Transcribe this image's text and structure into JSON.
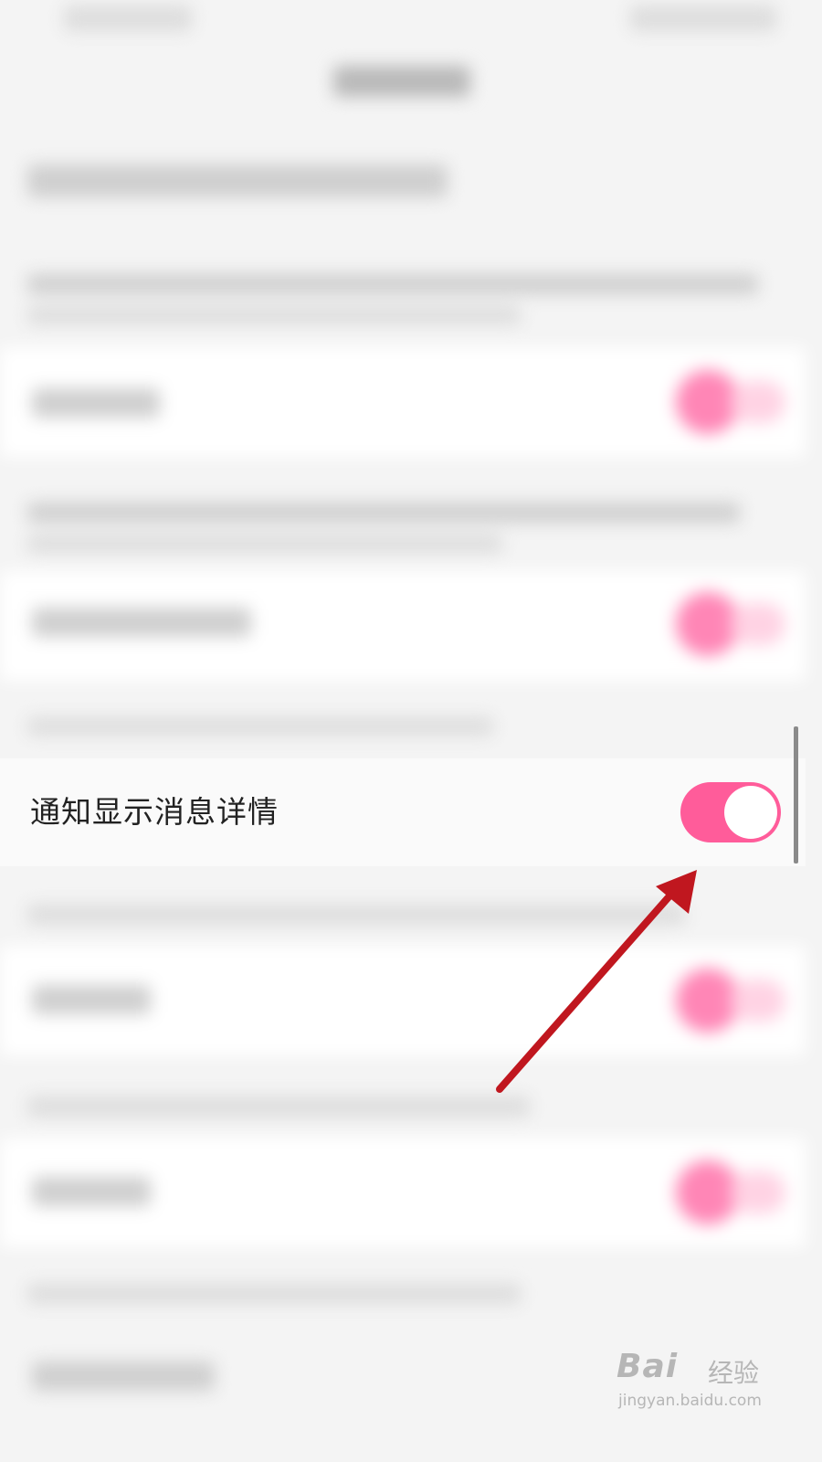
{
  "setting": {
    "label": "通知显示消息详情",
    "toggle_on": true
  },
  "watermark": {
    "brand": "Bai",
    "brand_suffix": "经验",
    "url": "jingyan.baidu.com"
  },
  "colors": {
    "accent": "#ff5c9a",
    "arrow": "#c0171f"
  }
}
